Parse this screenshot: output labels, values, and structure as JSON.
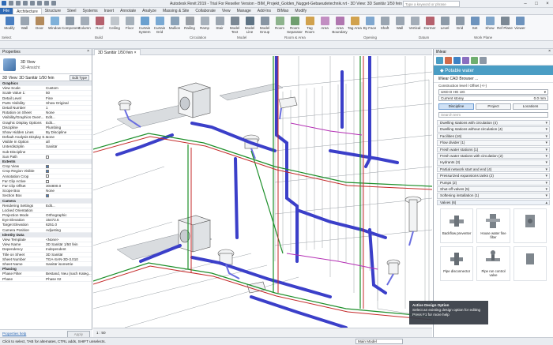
{
  "window": {
    "title": "Autodesk Revit 2019 - Trial For Reseller Version - BIM_Projekt_Golden_Nugget-Gebaeudetechnik.rvt - 3D View: 3D Sanitär 1/50 fein",
    "search_placeholder": "Type a keyword or phrase"
  },
  "tabs": [
    "File",
    "Architecture",
    "Structure",
    "Steel",
    "Systems",
    "Insert",
    "Annotate",
    "Analyze",
    "Massing & Site",
    "Collaborate",
    "View",
    "Manage",
    "Add-Ins",
    "BIMao",
    "Modify"
  ],
  "ribbon": {
    "tools": [
      {
        "label": "Modify",
        "color": "#4a7fc1"
      },
      {
        "label": "Wall",
        "color": "#9aa5b1"
      },
      {
        "label": "Door",
        "color": "#b38b5d"
      },
      {
        "label": "Window",
        "color": "#7fb1d9"
      },
      {
        "label": "Component",
        "color": "#8c9aa8"
      },
      {
        "label": "Column",
        "color": "#a3adb8"
      },
      {
        "label": "Roof",
        "color": "#b5616d"
      },
      {
        "label": "Ceiling",
        "color": "#c0c6cc"
      },
      {
        "label": "Floor",
        "color": "#a5b0ba"
      },
      {
        "label": "Curtain System",
        "color": "#6aa0cf"
      },
      {
        "label": "Curtain Grid",
        "color": "#79a9d3"
      },
      {
        "label": "Mullion",
        "color": "#8aa2b8"
      },
      {
        "label": "Railing",
        "color": "#999fa6"
      },
      {
        "label": "Ramp",
        "color": "#a7b1bb"
      },
      {
        "label": "Stair",
        "color": "#9ca6b0"
      },
      {
        "label": "Model Text",
        "color": "#7b8894"
      },
      {
        "label": "Model Line",
        "color": "#5f7485"
      },
      {
        "label": "Model Group",
        "color": "#8795a3"
      },
      {
        "label": "Room",
        "color": "#8db38d"
      },
      {
        "label": "Room Separator",
        "color": "#6f9e6f"
      },
      {
        "label": "Tag Room",
        "color": "#d1a24e"
      },
      {
        "label": "Area",
        "color": "#c28ec2"
      },
      {
        "label": "Area Boundary",
        "color": "#b077b0"
      },
      {
        "label": "Tag Area",
        "color": "#d1a24e"
      },
      {
        "label": "By Face",
        "color": "#7fa7cf"
      },
      {
        "label": "Shaft",
        "color": "#9aa5b1"
      },
      {
        "label": "Wall",
        "color": "#9aa5b1"
      },
      {
        "label": "Vertical",
        "color": "#a3adb8"
      },
      {
        "label": "Dormer",
        "color": "#b5616d"
      },
      {
        "label": "Level",
        "color": "#8c9aa8"
      },
      {
        "label": "Grid",
        "color": "#8c9aa8"
      },
      {
        "label": "Set",
        "color": "#6d93bd"
      },
      {
        "label": "Show",
        "color": "#7ea4c9"
      },
      {
        "label": "Ref Plane",
        "color": "#7b8894"
      },
      {
        "label": "Viewer",
        "color": "#6d93bd"
      }
    ],
    "groups": [
      "Select",
      "Build",
      "Circulation",
      "Model",
      "Room & Area",
      "Opening",
      "Datum",
      "Work Plane"
    ]
  },
  "properties": {
    "header": "Properties",
    "type_name": "3D View",
    "type_sub": "3D-Ansicht",
    "selector": "3D View: 3D Sanitär 1/50 fein",
    "edit_type": "Edit Type",
    "rows": [
      {
        "k": "Graphics",
        "v": "",
        "sec": true
      },
      {
        "k": "View Scale",
        "v": "Custom"
      },
      {
        "k": "Scale Value    1:",
        "v": "50"
      },
      {
        "k": "Detail Level",
        "v": "Fine"
      },
      {
        "k": "Parts Visibility",
        "v": "Show Original"
      },
      {
        "k": "Detail Number",
        "v": "1"
      },
      {
        "k": "Rotation on Sheet",
        "v": "None"
      },
      {
        "k": "Visibility/Graphics Overr...",
        "v": "Edit..."
      },
      {
        "k": "Graphic Display Options",
        "v": "Edit..."
      },
      {
        "k": "Discipline",
        "v": "Plumbing"
      },
      {
        "k": "Show Hidden Lines",
        "v": "By Discipline"
      },
      {
        "k": "Default Analysis Display S...",
        "v": "None"
      },
      {
        "k": "Visible In Option",
        "v": "all"
      },
      {
        "k": "Unterdisziplin",
        "v": "Sanitär"
      },
      {
        "k": "Sub-Discipline",
        "v": ""
      },
      {
        "k": "Sun Path",
        "v": "",
        "cb": "off"
      },
      {
        "k": "Extents",
        "v": "",
        "sec": true
      },
      {
        "k": "Crop View",
        "v": "",
        "cb": "on"
      },
      {
        "k": "Crop Region Visible",
        "v": "",
        "cb": "on"
      },
      {
        "k": "Annotation Crop",
        "v": "",
        "cb": "off"
      },
      {
        "k": "Far Clip Active",
        "v": "",
        "cb": "off"
      },
      {
        "k": "Far Clip Offset",
        "v": "304800.0"
      },
      {
        "k": "Scope Box",
        "v": "None"
      },
      {
        "k": "Section Box",
        "v": "",
        "cb": "on"
      },
      {
        "k": "Camera",
        "v": "",
        "sec": true
      },
      {
        "k": "Rendering Settings",
        "v": "Edit..."
      },
      {
        "k": "Locked Orientation",
        "v": ""
      },
      {
        "k": "Projection Mode",
        "v": "Orthographic"
      },
      {
        "k": "Eye Elevation",
        "v": "15472.6"
      },
      {
        "k": "Target Elevation",
        "v": "6251.0"
      },
      {
        "k": "Camera Position",
        "v": "Adjusting"
      },
      {
        "k": "Identity Data",
        "v": "",
        "sec": true
      },
      {
        "k": "View Template",
        "v": "<None>"
      },
      {
        "k": "View Name",
        "v": "3D Sanitär 1/50 fein"
      },
      {
        "k": "Dependency",
        "v": "Independent"
      },
      {
        "k": "Title on Sheet",
        "v": "3D Sanitär"
      },
      {
        "k": "Sheet Number",
        "v": "TGA-SAN-3D-3.010"
      },
      {
        "k": "Sheet Name",
        "v": "Sanitär isometrie"
      },
      {
        "k": "Phasing",
        "v": "",
        "sec": true
      },
      {
        "k": "Phase Filter",
        "v": "Bestand, Neu (nach Kateg..."
      },
      {
        "k": "Phase",
        "v": "Phase 02"
      }
    ],
    "help_link": "Properties help",
    "apply": "Apply"
  },
  "view_tab": "3D Sanitär 1/50 fein",
  "view_scale": "1 : 50",
  "ibwe": {
    "header": "liNear",
    "banner": "Potable water",
    "browser": "liNear CAD Browser ...",
    "construction_label": "Construction level / Offset (+/-)",
    "construction_value": "UKD D HG UG",
    "current_storey": "Current storey",
    "offset": "0.0 mm",
    "buttons": [
      "Discipline",
      "Project",
      "Locations"
    ],
    "search_placeholder": "Search term",
    "categories": [
      "Dwelling stations with circulation (4)",
      "Dwelling stations without circulation (4)",
      "Facilities (16)",
      "Flow divider (1)",
      "Fresh water stations (1)",
      "Fresh water stations with circulation (2)",
      "Hydrants (3)",
      "Partial network start and end (4)",
      "Pressurized expansions tanks (2)",
      "Pumps (2)",
      "Shut-off valves (5)",
      "Softening installation (1)",
      "Valves (6)"
    ],
    "valves": [
      "Backflow preventer",
      "House water fine filter",
      "Pipe disconnector",
      "Pipe run control valve"
    ]
  },
  "status": {
    "hint": "Click to select, TAB for alternates, CTRL adds, SHIFT unselects.",
    "model": "Main Model"
  },
  "tooltip": {
    "title": "Active Design Option",
    "line1": "Select an existing design option for editing",
    "line2": "Press F1 for more help"
  }
}
